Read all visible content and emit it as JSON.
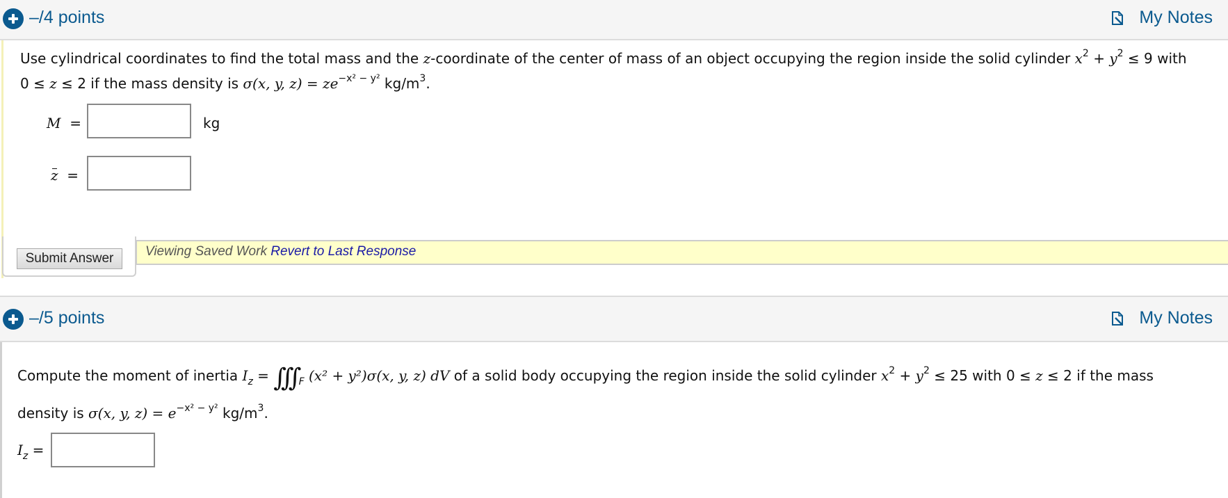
{
  "questions": [
    {
      "points_label": "–/4 points",
      "notes_label": "My Notes",
      "prompt": {
        "line1_prefix": "Use cylindrical coordinates to find the total mass and the ",
        "line1_z": "z",
        "line1_mid": "-coordinate of the center of mass of an object occupying the region inside the solid cylinder ",
        "line1_x": "x",
        "line1_exp2a": "2",
        "line1_plus": " + ",
        "line1_y": "y",
        "line1_exp2b": "2",
        "line1_suffix": " ≤ 9 with",
        "line2_prefix": "0 ≤ ",
        "line2_z": "z",
        "line2_mid": " ≤ 2 if the mass density is ",
        "line2_density": "σ(x, y, z) = ze",
        "line2_exponent": "−x² − y²",
        "line2_units": " kg/m",
        "line2_units_exp": "3",
        "line2_end": "."
      },
      "fields": [
        {
          "label": "M",
          "equals": "=",
          "value": "",
          "unit": "kg"
        },
        {
          "label": "z",
          "equals": "=",
          "value": "",
          "unit": ""
        }
      ],
      "submit_label": "Submit Answer",
      "saved_text": "Viewing Saved Work",
      "revert_label": "Revert to Last Response"
    },
    {
      "points_label": "–/5 points",
      "notes_label": "My Notes",
      "prompt": {
        "line1_prefix": "Compute the moment of inertia ",
        "line1_I": "I",
        "line1_Isub": "z",
        "line1_eq": " = ",
        "line1_integral": "∫∫∫",
        "line1_region": "F",
        "line1_integrand": " (x² + y²)σ(x, y, z) dV",
        "line1_mid": " of a solid body occupying the region inside the solid cylinder ",
        "line1_x": "x",
        "line1_exp2a": "2",
        "line1_plus": " + ",
        "line1_y": "y",
        "line1_exp2b": "2",
        "line1_suffix": " ≤ 25 with 0 ≤ ",
        "line1_z": "z",
        "line1_end": " ≤ 2 if the mass",
        "line2_prefix": "density is ",
        "line2_density": "σ(x, y, z) = e",
        "line2_exponent": "−x² − y²",
        "line2_units": " kg/m",
        "line2_units_exp": "3",
        "line2_end": "."
      },
      "fields": [
        {
          "label": "I",
          "label_sub": "z",
          "equals": "=",
          "value": ""
        }
      ]
    }
  ],
  "colors": {
    "accent": "#0b5a8f",
    "saved_bar_bg": "#ffffca",
    "link": "#1a1aa6"
  }
}
